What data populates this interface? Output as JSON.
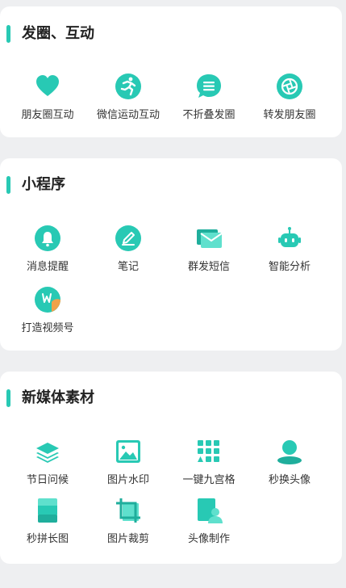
{
  "colors": {
    "accent": "#28c9b4",
    "accent_dark": "#1fae9c",
    "background": "#eeeff1",
    "card": "#ffffff"
  },
  "sections": [
    {
      "title": "发圈、互动",
      "items": [
        {
          "label": "朋友圈互动",
          "icon": "heart-icon"
        },
        {
          "label": "微信运动互动",
          "icon": "runner-icon"
        },
        {
          "label": "不折叠发圈",
          "icon": "message-lines-icon"
        },
        {
          "label": "转发朋友圈",
          "icon": "aperture-icon"
        }
      ]
    },
    {
      "title": "小程序",
      "items": [
        {
          "label": "消息提醒",
          "icon": "bell-icon"
        },
        {
          "label": "笔记",
          "icon": "pencil-icon"
        },
        {
          "label": "群发短信",
          "icon": "envelope-icon"
        },
        {
          "label": "智能分析",
          "icon": "robot-icon"
        },
        {
          "label": "打造视频号",
          "icon": "video-channel-icon"
        }
      ]
    },
    {
      "title": "新媒体素材",
      "items": [
        {
          "label": "节日问候",
          "icon": "layers-icon"
        },
        {
          "label": "图片水印",
          "icon": "image-icon"
        },
        {
          "label": "一键九宫格",
          "icon": "grid-icon"
        },
        {
          "label": "秒换头像",
          "icon": "avatar-swap-icon"
        },
        {
          "label": "秒拼长图",
          "icon": "long-image-icon"
        },
        {
          "label": "图片裁剪",
          "icon": "crop-icon"
        },
        {
          "label": "头像制作",
          "icon": "avatar-make-icon"
        }
      ]
    }
  ]
}
